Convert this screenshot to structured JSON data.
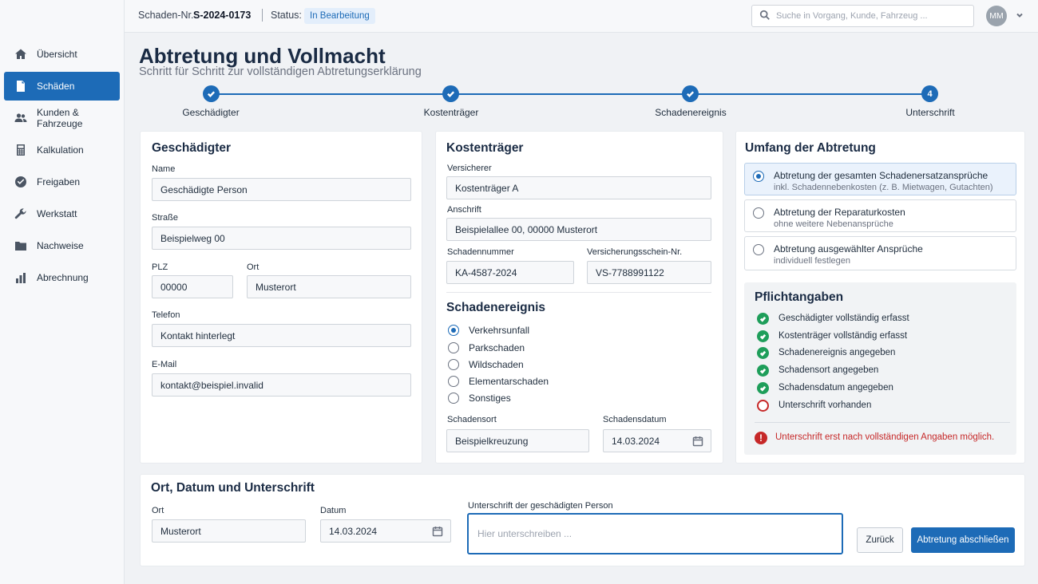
{
  "header": {
    "claim_label": "Schaden-Nr.",
    "claim_number": "S-2024-0173",
    "status_label": "Status:",
    "status_value": "In Bearbeitung",
    "search_placeholder": "Suche in Vorgang, Kunde, Fahrzeug ...",
    "user_initials": "MM"
  },
  "sidebar": {
    "items": [
      {
        "label": "Übersicht",
        "icon": "home-icon"
      },
      {
        "label": "Schäden",
        "icon": "document-icon",
        "active": true
      },
      {
        "label": "Kunden & Fahrzeuge",
        "icon": "people-icon"
      },
      {
        "label": "Kalkulation",
        "icon": "calculator-icon"
      },
      {
        "label": "Freigaben",
        "icon": "check-circle-icon"
      },
      {
        "label": "Werkstatt",
        "icon": "wrench-icon"
      },
      {
        "label": "Nachweise",
        "icon": "folder-icon"
      },
      {
        "label": "Abrechnung",
        "icon": "bar-chart-icon"
      }
    ]
  },
  "page": {
    "title": "Abtretung und Vollmacht",
    "subtitle": "Schritt für Schritt zur vollständigen Abtretungserklärung"
  },
  "stepper": {
    "steps": [
      {
        "label": "Geschädigter",
        "state": "done"
      },
      {
        "label": "Kostenträger",
        "state": "done"
      },
      {
        "label": "Schadenereignis",
        "state": "done"
      },
      {
        "label": "Unterschrift",
        "state": "current",
        "number": "4"
      }
    ]
  },
  "injured": {
    "heading": "Geschädigter",
    "name_label": "Name",
    "name_value": "Geschädigte Person",
    "street_label": "Straße",
    "street_value": "Beispielweg 00",
    "zip_label": "PLZ",
    "zip_value": "00000",
    "city_label": "Ort",
    "city_value": "Musterort",
    "phone_label": "Telefon",
    "phone_value": "Kontakt hinterlegt",
    "email_label": "E-Mail",
    "email_value": "kontakt@beispiel.invalid"
  },
  "payer": {
    "heading": "Kostenträger",
    "insurer_label": "Versicherer",
    "insurer_value": "Kostenträger A",
    "address_label": "Anschrift",
    "address_value": "Beispielallee 00, 00000 Musterort",
    "claimno_label": "Schadennummer",
    "claimno_value": "KA-4587-2024",
    "policy_label": "Versicherungsschein-Nr.",
    "policy_value": "VS-7788991122"
  },
  "event": {
    "heading": "Schadenereignis",
    "options": [
      {
        "label": "Verkehrsunfall",
        "selected": true
      },
      {
        "label": "Parkschaden",
        "selected": false
      },
      {
        "label": "Wildschaden",
        "selected": false
      },
      {
        "label": "Elementarschaden",
        "selected": false
      },
      {
        "label": "Sonstiges",
        "selected": false
      }
    ],
    "location_label": "Schadensort",
    "location_value": "Beispielkreuzung",
    "date_label": "Schadensdatum",
    "date_value": "14.03.2024"
  },
  "scope": {
    "heading": "Umfang der Abtretung",
    "options": [
      {
        "title": "Abtretung der gesamten Schadenersatzansprüche",
        "sub": "inkl. Schadennebenkosten (z. B. Mietwagen, Gutachten)",
        "selected": true
      },
      {
        "title": "Abtretung der Reparaturkosten",
        "sub": "ohne weitere Nebenansprüche",
        "selected": false
      },
      {
        "title": "Abtretung ausgewählter Ansprüche",
        "sub": "individuell festlegen",
        "selected": false
      }
    ]
  },
  "required": {
    "heading": "Pflichtangaben",
    "items": [
      {
        "label": "Geschädigter vollständig erfasst",
        "ok": true
      },
      {
        "label": "Kostenträger vollständig erfasst",
        "ok": true
      },
      {
        "label": "Schadenereignis angegeben",
        "ok": true
      },
      {
        "label": "Schadensort angegeben",
        "ok": true
      },
      {
        "label": "Schadensdatum angegeben",
        "ok": true
      },
      {
        "label": "Unterschrift vorhanden",
        "ok": false
      }
    ],
    "warning": "Unterschrift erst nach vollständigen Angaben möglich."
  },
  "signature": {
    "heading": "Ort, Datum und Unterschrift",
    "place_label": "Ort",
    "place_value": "Musterort",
    "date_label": "Datum",
    "date_value": "14.03.2024",
    "sig_label": "Unterschrift der geschädigten Person",
    "sig_placeholder": "Hier unterschreiben ...",
    "back_button": "Zurück",
    "finish_button": "Abtretung abschließen"
  },
  "colors": {
    "accent": "#1d6bb7",
    "success": "#1e9e5a",
    "error": "#c62828"
  }
}
